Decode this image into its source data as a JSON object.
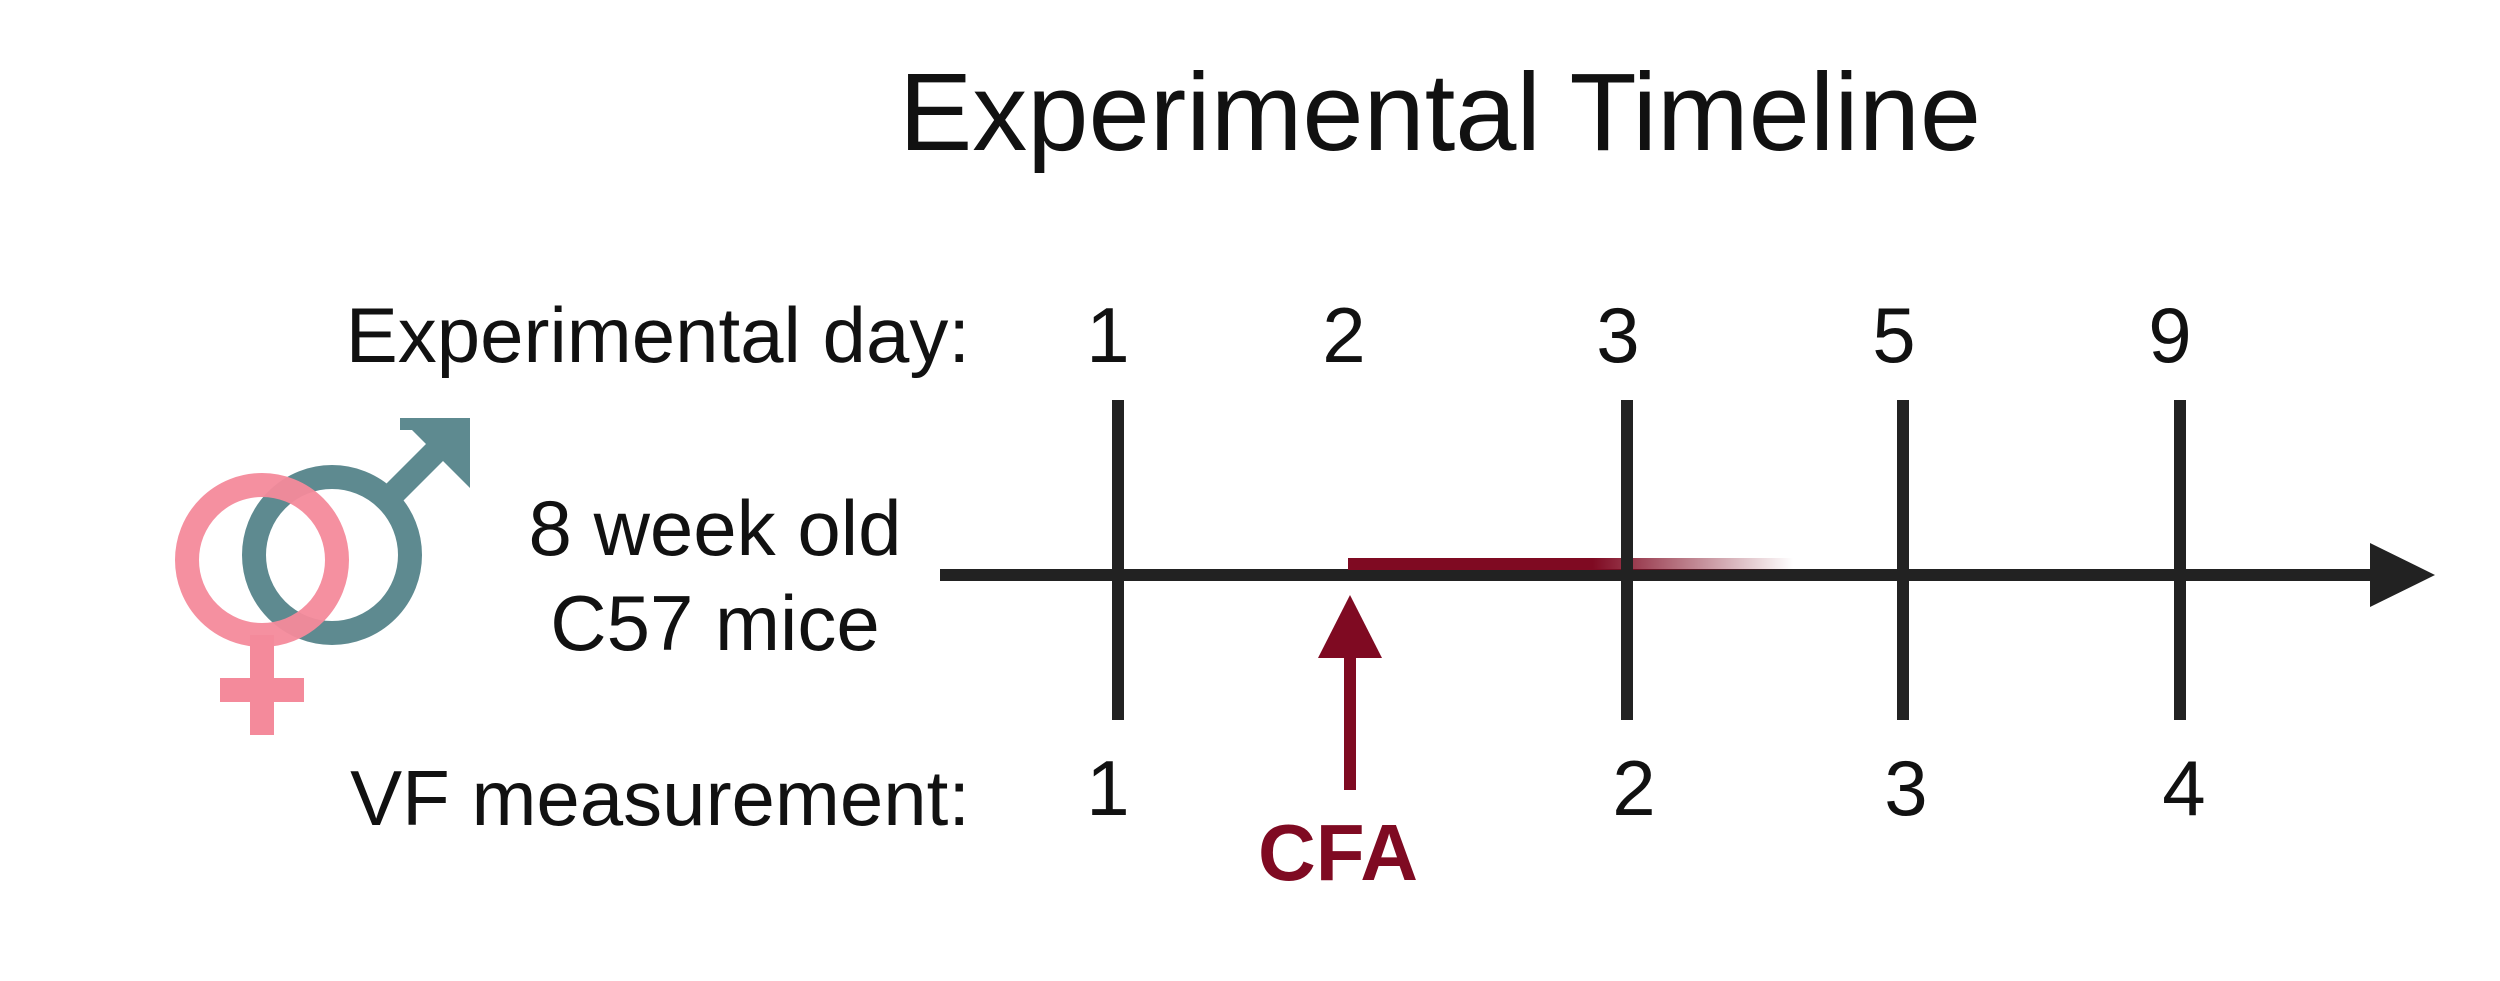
{
  "title": "Experimental Timeline",
  "experimental_day_label": "Experimental day:",
  "vf_measurement_label": "VF measurement:",
  "subject_line1": "8 week old",
  "subject_line2": "C57 mice",
  "experimental_days": [
    "1",
    "2",
    "3",
    "5",
    "9"
  ],
  "vf_measurements": [
    "1",
    "2",
    "3",
    "4"
  ],
  "injection_label": "CFA",
  "icons": {
    "female": "female-symbol-icon",
    "male": "male-symbol-icon"
  },
  "colors": {
    "timeline": "#222222",
    "cfa": "#7f0a22",
    "female": "#f48a9b",
    "male": "#5e8a90",
    "text": "#111111"
  }
}
